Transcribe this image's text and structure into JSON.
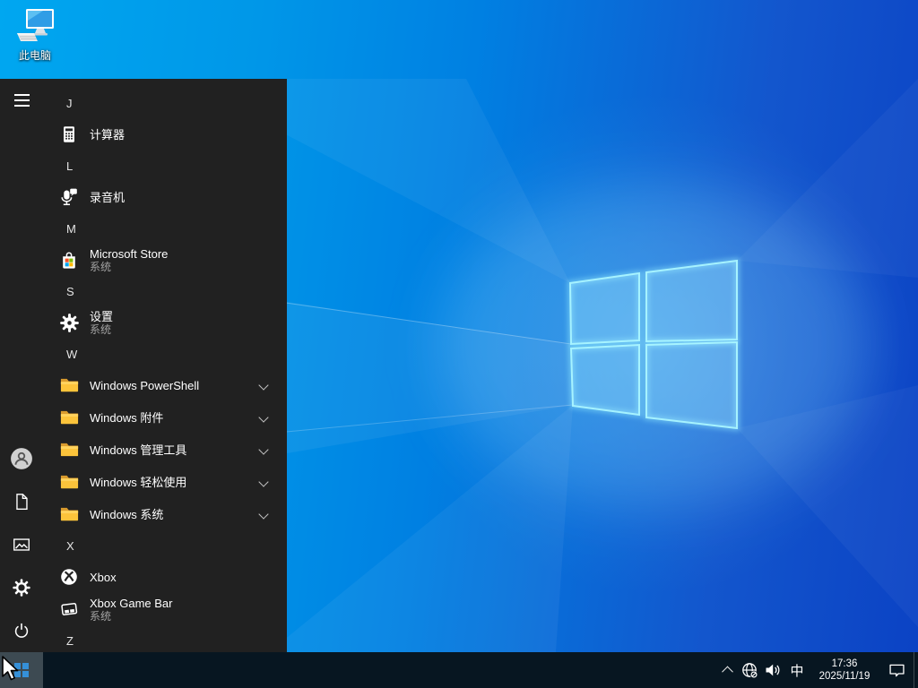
{
  "desktop": {
    "this_pc_label": "此电脑"
  },
  "start_menu": {
    "sections": [
      {
        "letter": "J"
      },
      {
        "letter": "L"
      },
      {
        "letter": "M"
      },
      {
        "letter": "S"
      },
      {
        "letter": "W"
      },
      {
        "letter": "X"
      },
      {
        "letter": "Z"
      }
    ],
    "items": {
      "calculator": {
        "label": "计算器"
      },
      "voice_recorder": {
        "label": "录音机"
      },
      "microsoft_store": {
        "label": "Microsoft Store",
        "sub": "系统"
      },
      "settings": {
        "label": "设置",
        "sub": "系统"
      },
      "powershell": {
        "label": "Windows PowerShell"
      },
      "accessories": {
        "label": "Windows 附件"
      },
      "admin_tools": {
        "label": "Windows 管理工具"
      },
      "ease_of_access": {
        "label": "Windows 轻松使用"
      },
      "system_folder": {
        "label": "Windows 系统"
      },
      "xbox": {
        "label": "Xbox"
      },
      "xbox_game_bar": {
        "label": "Xbox Game Bar",
        "sub": "系统"
      }
    },
    "rail_icons": [
      "hamburger-icon",
      "user-icon",
      "documents-icon",
      "pictures-icon",
      "settings-icon",
      "power-icon"
    ]
  },
  "taskbar": {
    "ime": "中",
    "time": "17:36",
    "date": "2025/11/19",
    "tray_icons": [
      "chevron-up-icon",
      "network-globe-offline-icon",
      "speaker-icon",
      "action-center-icon"
    ]
  },
  "colors": {
    "menu_bg": "#212121",
    "taskbar_bg": "#071621",
    "start_button_bg": "#3d4a52",
    "taskbar_logo_blue": "#3590d8",
    "wallpaper_left": "#00a7f0",
    "wallpaper_right": "#0b42c4",
    "logo_edge_cyan": "#a5f0ff",
    "folder_yellow": "#fcc43b",
    "store_red": "#f25022",
    "store_green": "#7fba00",
    "store_blue": "#00a4ef",
    "store_yellow": "#ffb900"
  }
}
